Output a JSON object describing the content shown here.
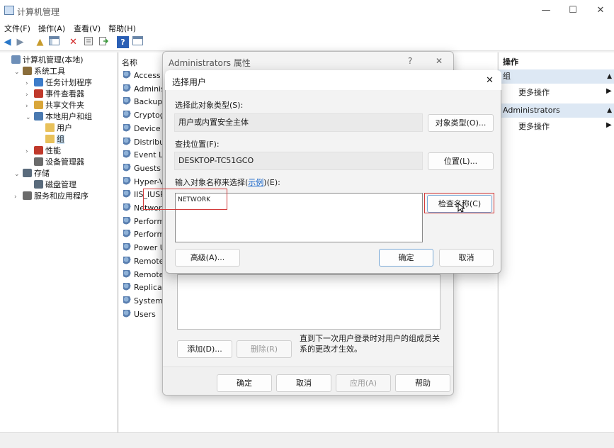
{
  "window": {
    "title": "计算机管理",
    "controls": {
      "minimize": "—",
      "maximize": "☐",
      "close": "✕"
    }
  },
  "menu": [
    "文件(F)",
    "操作(A)",
    "查看(V)",
    "帮助(H)"
  ],
  "tree": [
    {
      "label": "计算机管理(本地)",
      "arrow": "",
      "icon": "computer-icon",
      "level": 0
    },
    {
      "label": "系统工具",
      "arrow": "⌄",
      "icon": "tools-icon",
      "level": 1
    },
    {
      "label": "任务计划程序",
      "arrow": "›",
      "icon": "clock-icon",
      "level": 2
    },
    {
      "label": "事件查看器",
      "arrow": "›",
      "icon": "event-icon",
      "level": 2
    },
    {
      "label": "共享文件夹",
      "arrow": "›",
      "icon": "share-folder-icon",
      "level": 2
    },
    {
      "label": "本地用户和组",
      "arrow": "⌄",
      "icon": "users-icon",
      "level": 2
    },
    {
      "label": "用户",
      "arrow": "",
      "icon": "folder-icon",
      "level": 3
    },
    {
      "label": "组",
      "arrow": "",
      "icon": "folder-icon",
      "level": 3,
      "selected": true
    },
    {
      "label": "性能",
      "arrow": "›",
      "icon": "performance-icon",
      "level": 2
    },
    {
      "label": "设备管理器",
      "arrow": "",
      "icon": "device-manager-icon",
      "level": 2
    },
    {
      "label": "存储",
      "arrow": "⌄",
      "icon": "storage-icon",
      "level": 1
    },
    {
      "label": "磁盘管理",
      "arrow": "",
      "icon": "disk-icon",
      "level": 2
    },
    {
      "label": "服务和应用程序",
      "arrow": "›",
      "icon": "services-icon",
      "level": 1
    }
  ],
  "list": {
    "header": "名称",
    "rows": [
      "Access C",
      "Adminis",
      "Backup C",
      "Cryptog",
      "Device C",
      "Distribut",
      "Event Lo",
      "Guests",
      "Hyper-V",
      "IIS_IUSR",
      "Network",
      "Perform",
      "Perform",
      "Power U",
      "Remote",
      "Remote",
      "Replicat",
      "System I",
      "Users"
    ]
  },
  "actions": {
    "head1": "操作",
    "head2": "组",
    "item1": "更多操作",
    "head3": "Administrators",
    "item2": "更多操作"
  },
  "props_dialog": {
    "title": "Administrators 属性",
    "help": "?",
    "close": "✕",
    "note": "直到下一次用户登录时对用户的组成员关系的更改才生效。",
    "add": "添加(D)...",
    "remove": "删除(R)",
    "ok": "确定",
    "cancel": "取消",
    "apply": "应用(A)",
    "help_btn": "帮助"
  },
  "select_dialog": {
    "title": "选择用户",
    "close": "✕",
    "object_type_label": "选择此对象类型(S):",
    "object_type_value": "用户或内置安全主体",
    "object_type_button": "对象类型(O)...",
    "location_label": "查找位置(F):",
    "location_value": "DESKTOP-TC51GCO",
    "location_button": "位置(L)...",
    "names_label_pre": "输入对象名称来选择(",
    "names_label_link": "示例",
    "names_label_post": ")(E):",
    "names_value": "NETWORK",
    "check_names": "检查名称(C)",
    "advanced": "高级(A)...",
    "ok": "确定",
    "cancel": "取消"
  }
}
